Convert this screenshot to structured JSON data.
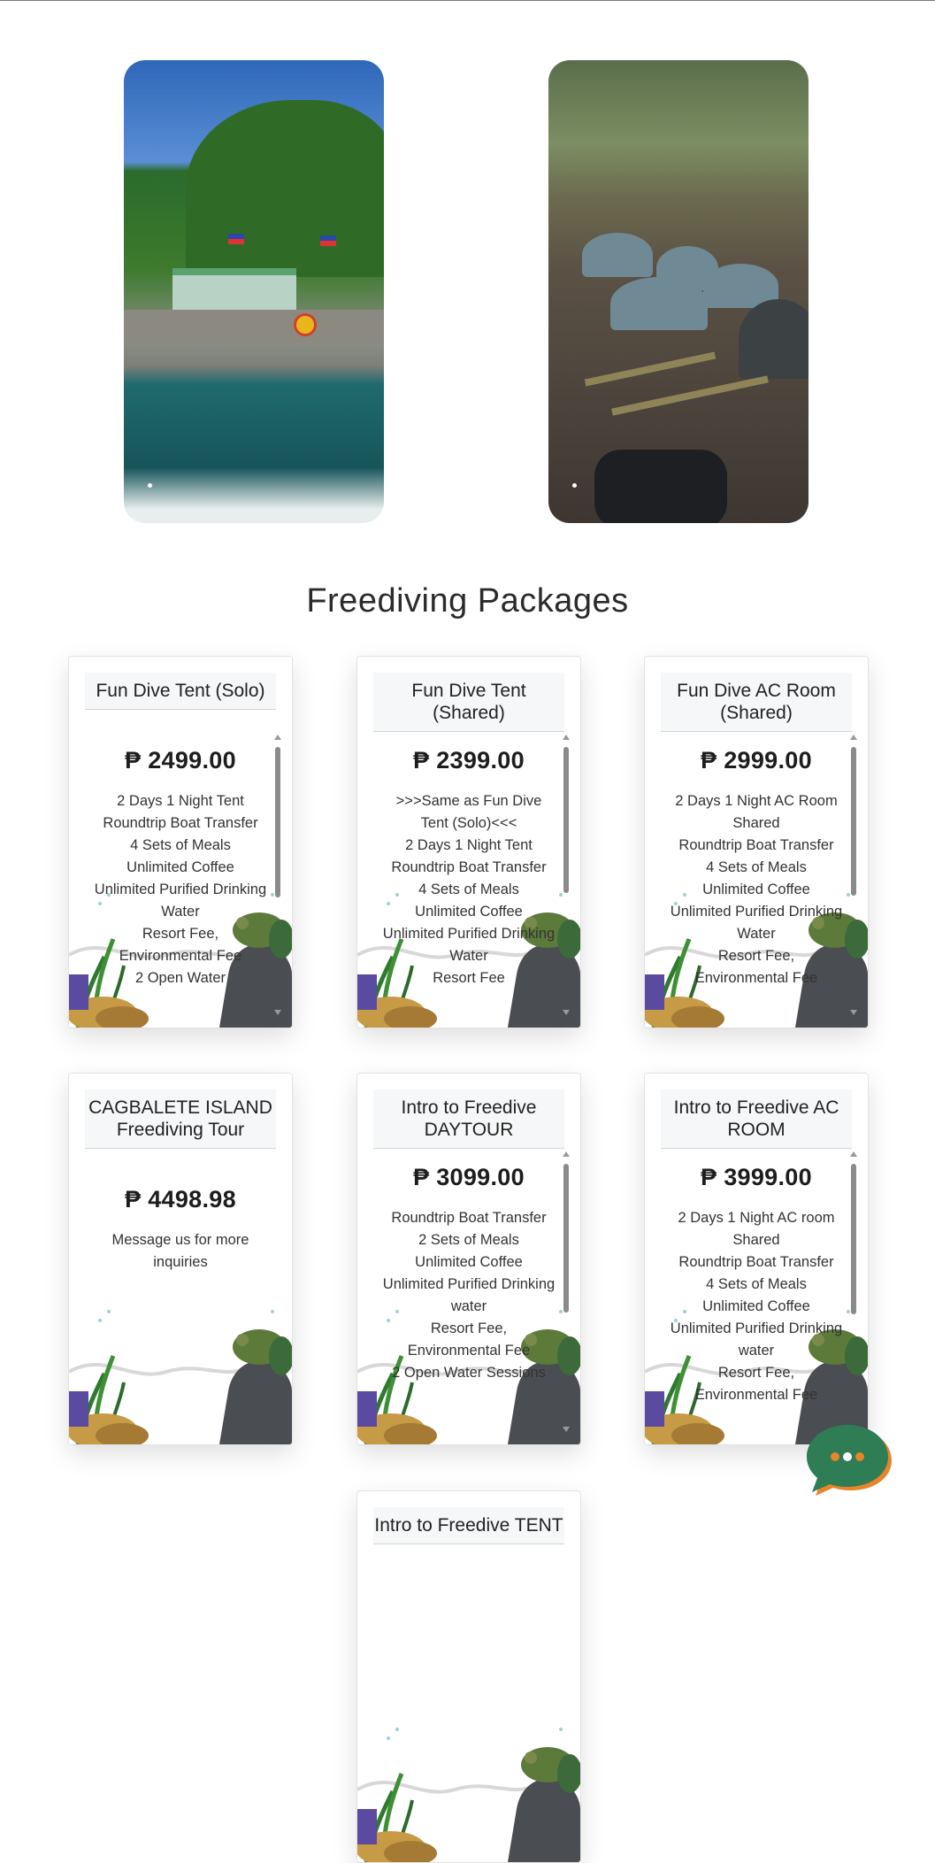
{
  "section_title": "Freediving Packages",
  "carousel": [
    {
      "name": "island-photo"
    },
    {
      "name": "campsite-photo"
    }
  ],
  "packages": [
    {
      "title": "Fun Dive Tent (Solo)",
      "price": "₱ 2499.00",
      "features": [
        "2 Days 1 Night Tent",
        "Roundtrip Boat Transfer",
        "4 Sets of Meals",
        "Unlimited Coffee",
        "Unlimited Purified Drinking Water",
        "Resort Fee,",
        "Environmental Fee",
        "2 Open Water"
      ]
    },
    {
      "title": "Fun Dive Tent (Shared)",
      "price": "₱ 2399.00",
      "features": [
        ">>>Same as Fun Dive Tent (Solo)<<<",
        "2 Days 1 Night Tent",
        "Roundtrip Boat Transfer",
        "4 Sets of Meals",
        "Unlimited Coffee",
        "Unlimited Purified Drinking Water",
        "Resort Fee"
      ]
    },
    {
      "title": "Fun Dive AC Room (Shared)",
      "price": "₱ 2999.00",
      "features": [
        "2 Days 1 Night AC Room Shared",
        "Roundtrip Boat Transfer",
        "4 Sets of Meals",
        "Unlimited Coffee",
        "Unlimited Purified Drinking Water",
        "Resort Fee,",
        "Environmental Fee"
      ]
    },
    {
      "title": "CAGBALETE ISLAND Freediving Tour",
      "price": "₱ 4498.98",
      "features": [
        "Message us for more inquiries"
      ]
    },
    {
      "title": "Intro to Freedive DAYTOUR",
      "price": "₱ 3099.00",
      "features": [
        "Roundtrip Boat Transfer",
        "2 Sets of Meals",
        "Unlimited Coffee",
        "Unlimited Purified Drinking water",
        "Resort Fee,",
        "Environmental Fee",
        "2 Open Water Sessions"
      ]
    },
    {
      "title": "Intro to Freedive AC ROOM",
      "price": "₱ 3999.00",
      "features": [
        "2 Days 1 Night AC room Shared",
        "Roundtrip Boat Transfer",
        "4 Sets of Meals",
        "Unlimited Coffee",
        "Unlimited Purified Drinking water",
        "Resort Fee,",
        "Environmental Fee"
      ]
    },
    {
      "title": "Intro to Freedive TENT",
      "price": "",
      "features": []
    }
  ],
  "chat_button": {
    "icon": "chat-bubble-icon"
  },
  "colors": {
    "chat_green": "#2e7d55",
    "chat_orange": "#e8842a"
  }
}
